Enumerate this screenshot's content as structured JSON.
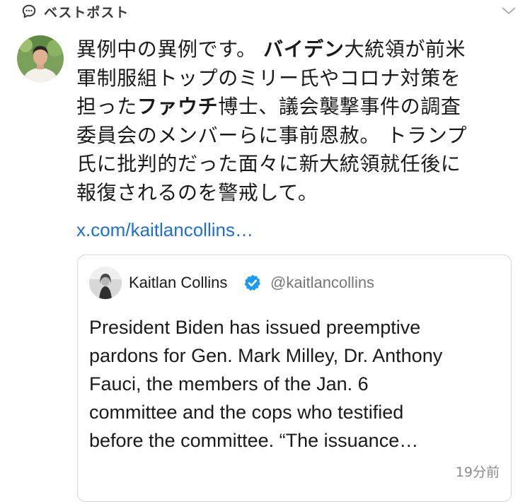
{
  "section": {
    "title": "ベストポスト"
  },
  "post": {
    "lines": [
      [
        {
          "text": "異例中の異例です。 ",
          "bold": false
        },
        {
          "text": "バイデン",
          "bold": true
        },
        {
          "text": "大統領が前米",
          "bold": false
        }
      ],
      [
        {
          "text": "軍制服組トップのミリー氏やコロナ対策を",
          "bold": false
        }
      ],
      [
        {
          "text": "担った",
          "bold": false
        },
        {
          "text": "ファウチ",
          "bold": true
        },
        {
          "text": "博士、議会襲撃事件の調査",
          "bold": false
        }
      ],
      [
        {
          "text": "委員会のメンバーらに事前恩赦。 トランプ",
          "bold": false
        }
      ],
      [
        {
          "text": "氏に批判的だった面々に新大統領就任後に",
          "bold": false
        }
      ],
      [
        {
          "text": "報復されるのを警戒して。",
          "bold": false
        }
      ]
    ],
    "link": "x.com/kaitlancollins…"
  },
  "quote": {
    "name": "Kaitlan Collins",
    "handle": "@kaitlancollins",
    "body_lines": [
      "President Biden has issued preemptive",
      "pardons for Gen. Mark Milley, Dr. Anthony",
      "Fauci, the members of the Jan. 6",
      "committee and the cops who testified",
      "before the committee. “The issuance…"
    ],
    "time": "19分前"
  },
  "icons": {
    "header": "speech-bubble-icon",
    "collapse": "chevron-down-icon",
    "verified": "verified-badge-icon"
  },
  "colors": {
    "link": "#1d6fd6",
    "verified": "#1d9bf0",
    "border": "#d6d6d6",
    "muted": "#777777"
  }
}
